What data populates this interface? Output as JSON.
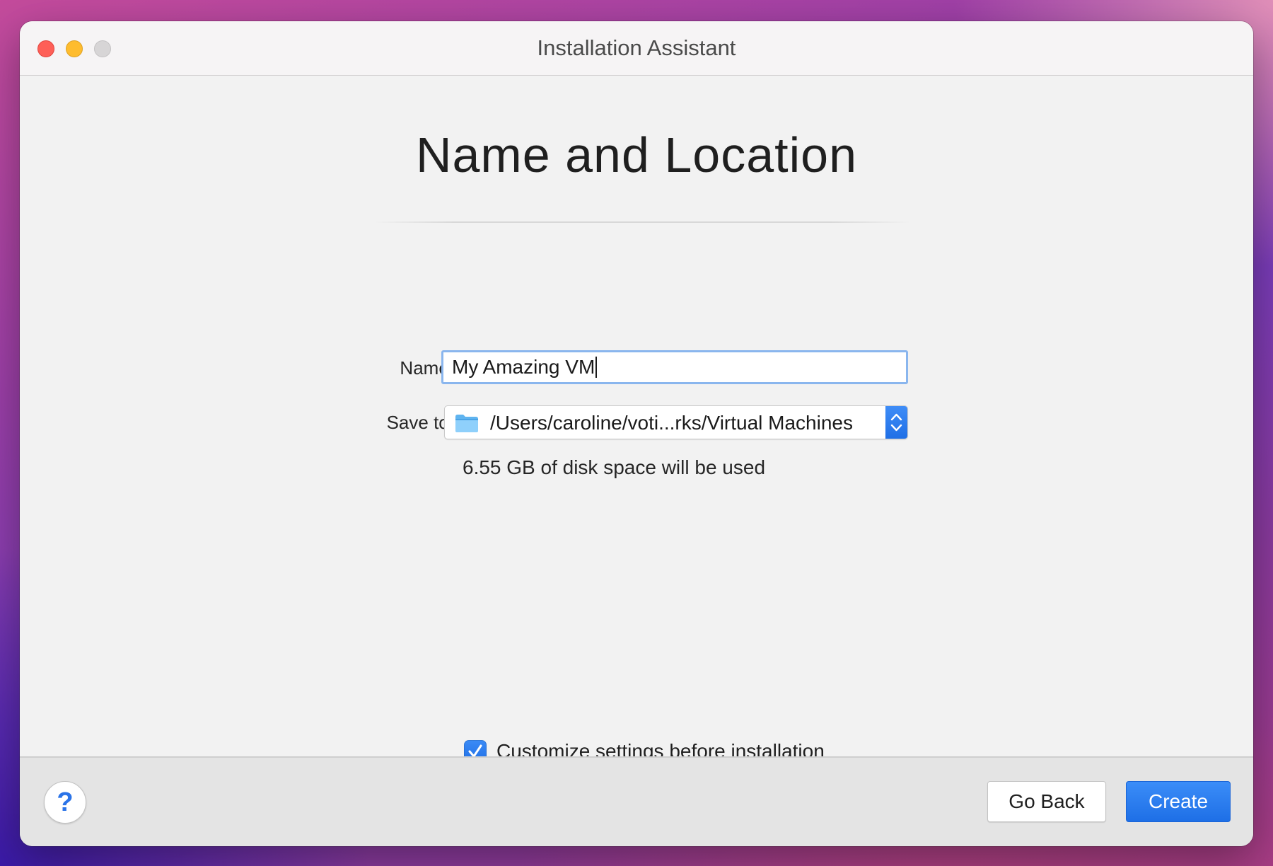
{
  "window": {
    "title": "Installation Assistant"
  },
  "page": {
    "heading": "Name and Location"
  },
  "form": {
    "name_label": "Name:",
    "name_value": "My Amazing VM",
    "save_to_label": "Save to:",
    "save_to_path": "/Users/caroline/voti...rks/Virtual Machines",
    "disk_space_note": "6.55 GB of disk space will be used",
    "customize_checkbox": {
      "label": "Customize settings before installation",
      "checked": true
    }
  },
  "footer": {
    "help_label": "?",
    "go_back_label": "Go Back",
    "create_label": "Create"
  },
  "icons": {
    "close": "close-traffic-light",
    "minimize": "minimize-traffic-light",
    "maximize": "zoom-traffic-light-disabled",
    "folder": "folder-icon",
    "stepper": "updown-chevron-icon",
    "checkmark": "checkmark-icon"
  },
  "colors": {
    "accent": "#1f6fe6",
    "close": "#fe5f57",
    "minimize": "#febc2e",
    "maximize_disabled": "#d7d5d6",
    "focus_ring": "#8ab6ee"
  }
}
